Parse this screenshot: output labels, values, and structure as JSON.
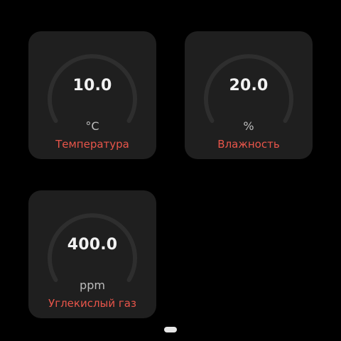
{
  "colors": {
    "background": "#000000",
    "tile_background": "#1f1f1f",
    "track": "#2e2e2e",
    "value_text": "#f2f2f2",
    "unit_text": "#bdbdbd",
    "label_accent": "#e8554a",
    "pager_dot": "#e6e6e6"
  },
  "tiles": [
    {
      "value": "10.0",
      "unit": "°C",
      "label": "Температура"
    },
    {
      "value": "20.0",
      "unit": "%",
      "label": "Влажность"
    },
    {
      "value": "400.0",
      "unit": "ppm",
      "label": "Углекислый газ"
    }
  ],
  "pager": {
    "icon": "page-indicator-icon"
  }
}
